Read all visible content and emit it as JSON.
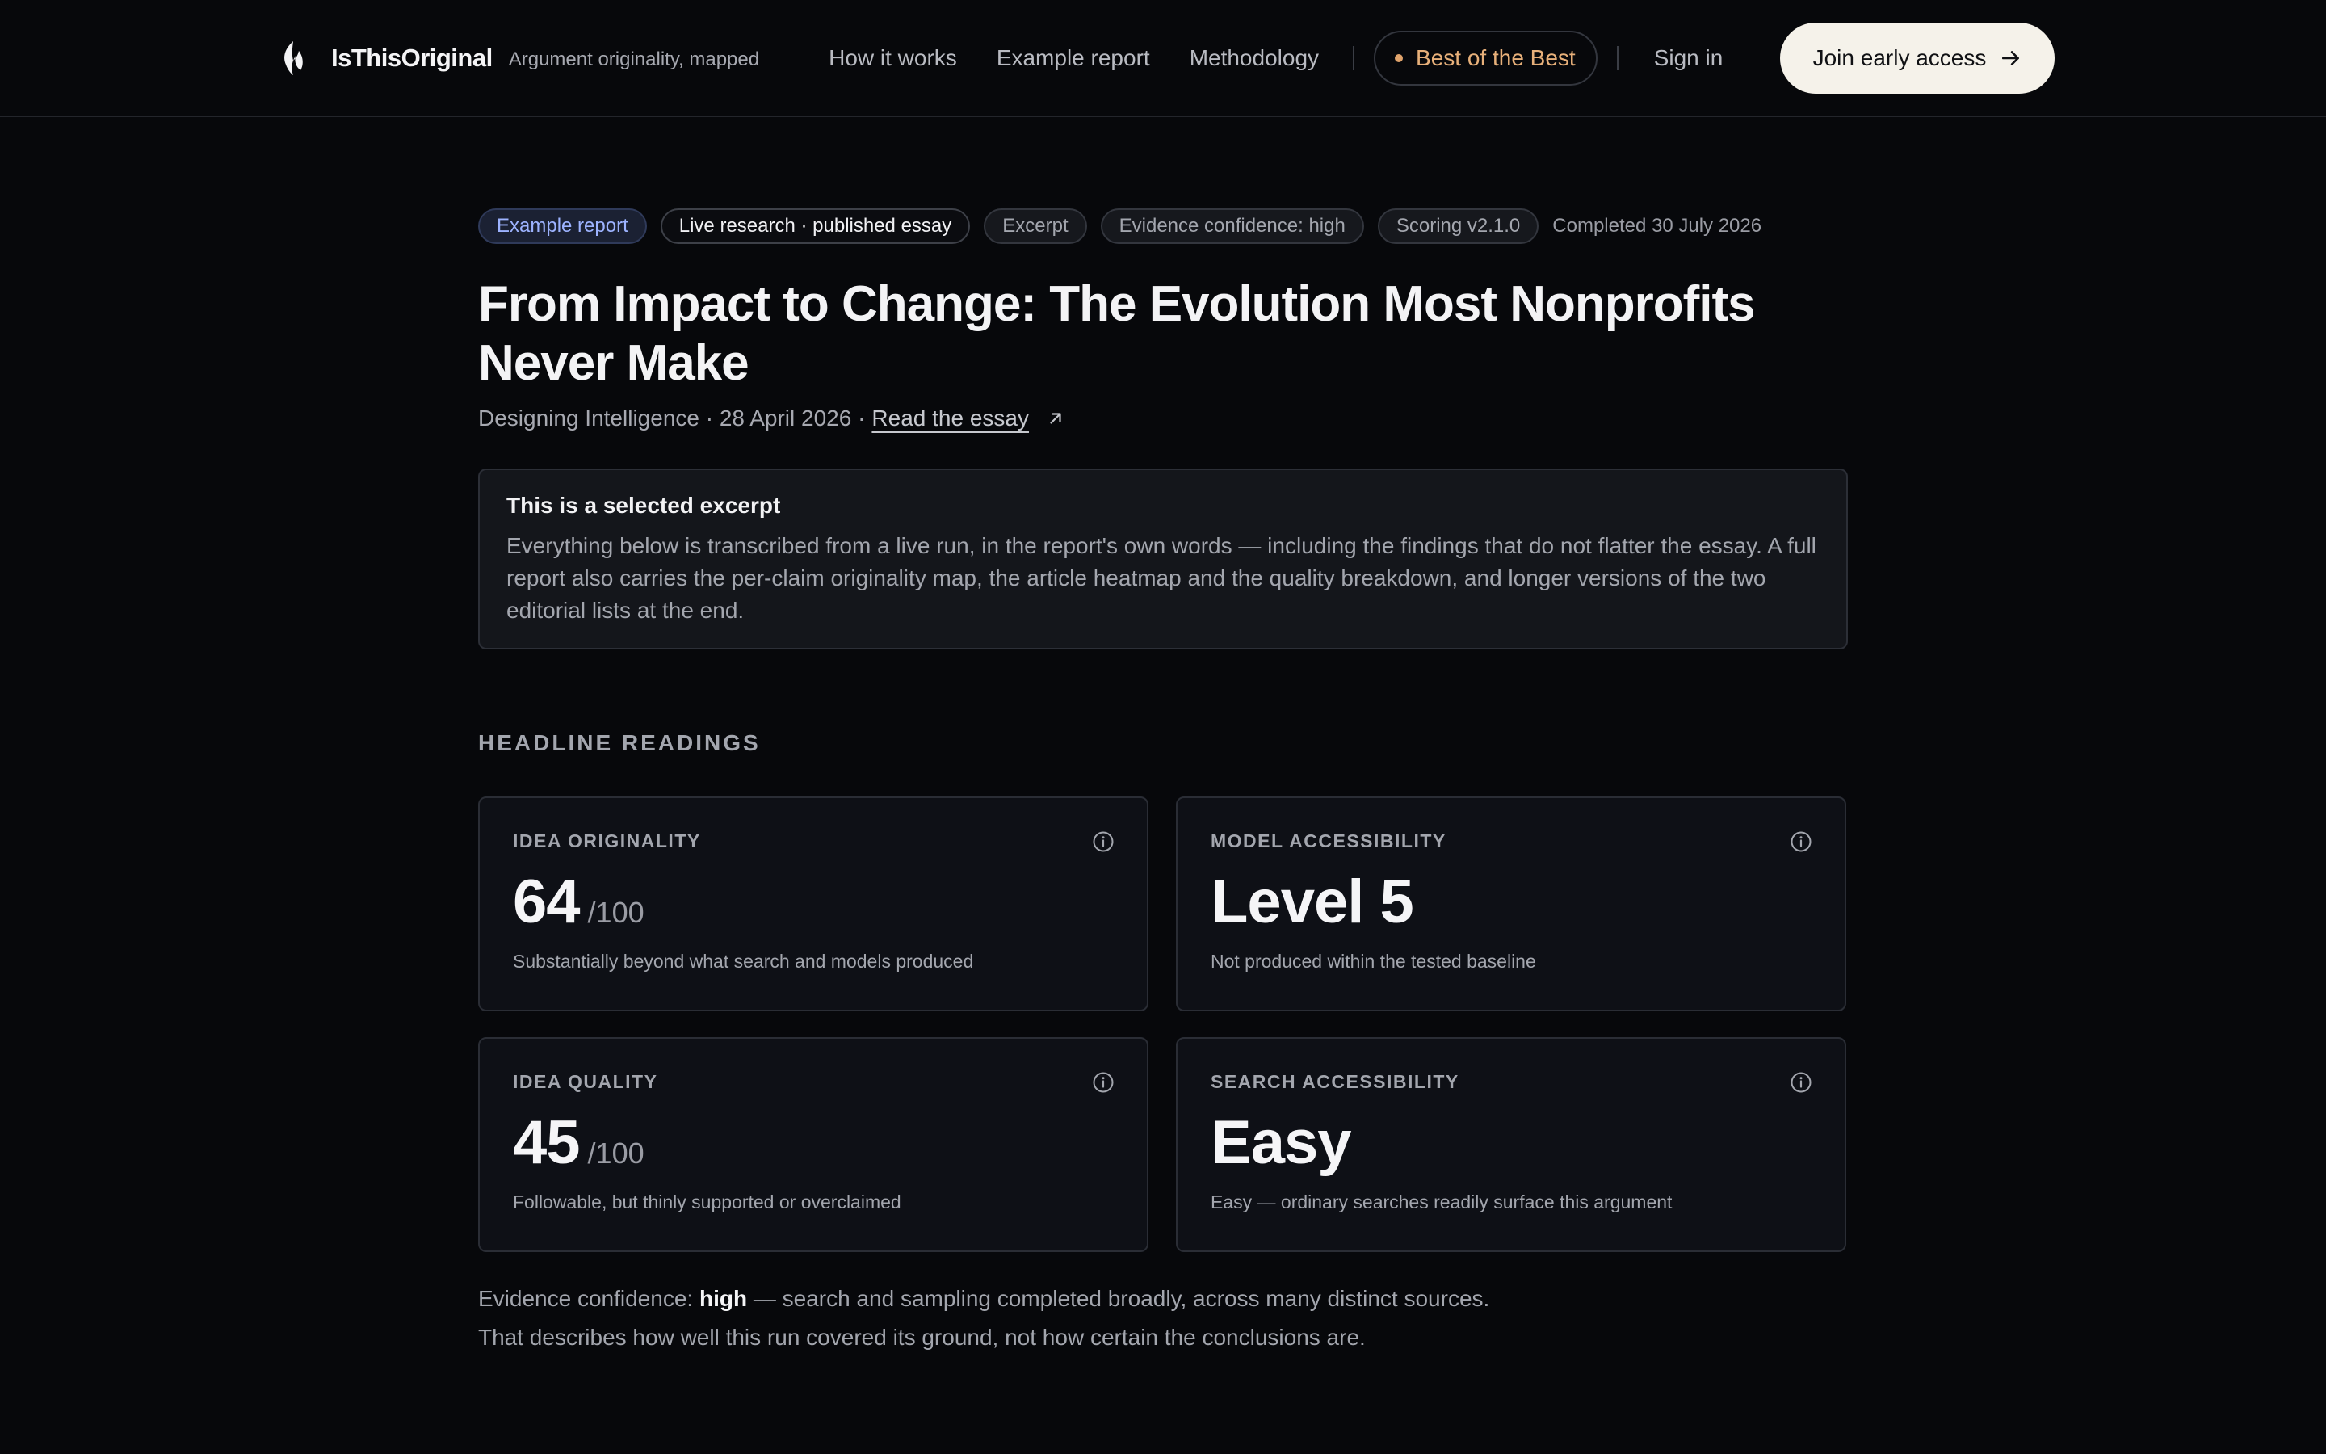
{
  "nav": {
    "brand_name": "IsThisOriginal",
    "brand_tagline": "Argument originality, mapped",
    "links": [
      "How it works",
      "Example report",
      "Methodology"
    ],
    "best_label": "Best of the Best",
    "signin_label": "Sign in",
    "cta_label": "Join early access",
    "accent_color": "#e7b07a"
  },
  "report": {
    "tags": [
      "Example report",
      "Live research · published essay",
      "Excerpt",
      "Evidence confidence: high",
      "Scoring v2.1.0"
    ],
    "completed": "Completed 30 July 2026",
    "title": "From Impact to Change: The Evolution Most Nonprofits Never Make",
    "meta_prefix": "Designing Intelligence · 28 April 2026 ·",
    "read_link": "Read the essay",
    "excerpt_heading": "This is a selected excerpt",
    "excerpt_body": "Everything below is transcribed from a live run, in the report's own words — including the findings that do not flatter the essay. A full report also carries the per-claim originality map, the article heatmap and the quality breakdown, and longer versions of the two editorial lists at the end."
  },
  "readings": {
    "heading": "HEADLINE READINGS",
    "cards": [
      {
        "label": "IDEA ORIGINALITY",
        "value": "64",
        "denominator": "/100",
        "desc": "Substantially beyond what search and models produced"
      },
      {
        "label": "MODEL ACCESSIBILITY",
        "value": "Level 5",
        "denominator": "",
        "desc": "Not produced within the tested baseline"
      },
      {
        "label": "IDEA QUALITY",
        "value": "45",
        "denominator": "/100",
        "desc": "Followable, but thinly supported or overclaimed"
      },
      {
        "label": "SEARCH ACCESSIBILITY",
        "value": "Easy",
        "denominator": "",
        "desc": "Easy — ordinary searches readily surface this argument"
      }
    ]
  },
  "confidence": {
    "prefix": "Evidence confidence:",
    "level": "high",
    "suffix": "— search and sampling completed broadly, across many distinct sources. That describes how well this run covered its ground, not how certain the conclusions are."
  }
}
